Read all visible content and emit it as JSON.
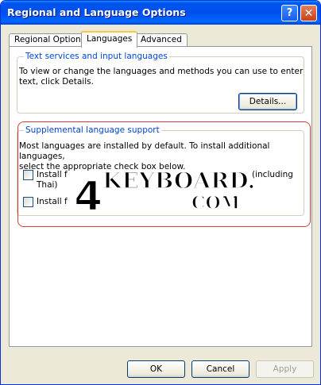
{
  "window": {
    "title": "Regional and Language Options",
    "help_glyph": "?",
    "close_glyph": "✕"
  },
  "tabs": [
    {
      "label": "Regional Options",
      "active": false
    },
    {
      "label": "Languages",
      "active": true
    },
    {
      "label": "Advanced",
      "active": false
    }
  ],
  "text_services": {
    "legend": "Text services and input languages",
    "description_line1": "To view or change the languages and methods you can use to enter",
    "description_line2": "text, click Details.",
    "details_button": "Details..."
  },
  "supplemental": {
    "legend": "Supplemental language support",
    "description_line1": "Most languages are installed by default. To install additional languages,",
    "description_line2": "select the appropriate check box below.",
    "option1_line1": "Install f",
    "option1_line1_tail": "(including",
    "option1_line2": "Thai)",
    "option2": "Install f"
  },
  "watermark": {
    "digit": "4",
    "word": "KEYBOARD.",
    "suffix": "COM"
  },
  "footer": {
    "ok": "OK",
    "cancel": "Cancel",
    "apply": "Apply"
  }
}
